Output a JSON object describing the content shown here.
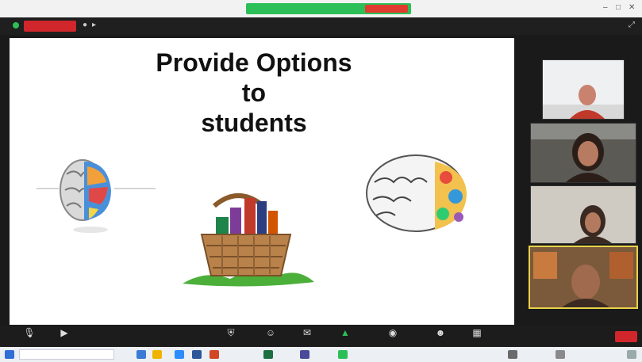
{
  "window": {
    "app_name": "",
    "controls": [
      "–",
      "□",
      "✕"
    ]
  },
  "share_banner": {
    "text": "",
    "stop_label": ""
  },
  "recording": {
    "label": ""
  },
  "slide": {
    "title_lines": [
      "Provide Options",
      "to",
      "students"
    ],
    "images": [
      "brain-left-right-illustration",
      "basket-of-books-illustration",
      "change-your-mindset-brain-illustration"
    ]
  },
  "participants": [
    {
      "name": "participant-1"
    },
    {
      "name": "participant-2"
    },
    {
      "name": "participant-3"
    },
    {
      "name": "participant-4"
    }
  ],
  "toolbar": {
    "buttons": [
      {
        "icon": "mic-icon",
        "label": ""
      },
      {
        "icon": "video-icon",
        "label": ""
      },
      {
        "icon": "security-icon",
        "label": ""
      },
      {
        "icon": "participants-icon",
        "label": ""
      },
      {
        "icon": "chat-icon",
        "label": ""
      },
      {
        "icon": "share-screen-icon",
        "label": ""
      },
      {
        "icon": "record-icon",
        "label": ""
      },
      {
        "icon": "reactions-icon",
        "label": ""
      },
      {
        "icon": "apps-icon",
        "label": ""
      }
    ],
    "end_label": ""
  },
  "taskbar": {
    "search_placeholder": ""
  },
  "colors": {
    "zoom_green": "#2dbf57",
    "zoom_red": "#d1262b",
    "active_speaker": "#e8d24a"
  }
}
